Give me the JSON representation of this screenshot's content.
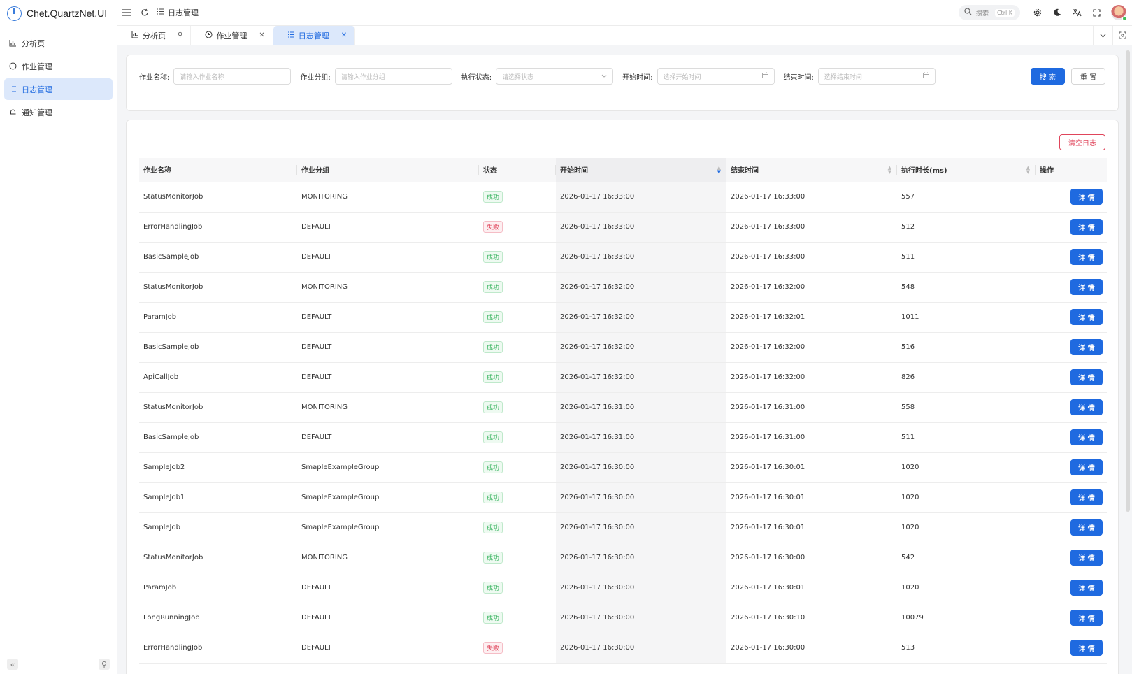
{
  "app": {
    "title": "Chet.QuartzNet.UI"
  },
  "sidebar": {
    "items": [
      {
        "label": "分析页",
        "icon": "chart-icon",
        "active": false
      },
      {
        "label": "作业管理",
        "icon": "clock-icon",
        "active": false
      },
      {
        "label": "日志管理",
        "icon": "list-icon",
        "active": true
      },
      {
        "label": "通知管理",
        "icon": "bell-icon",
        "active": false
      }
    ]
  },
  "header": {
    "breadcrumb": "日志管理",
    "search_placeholder": "搜索",
    "search_shortcut": "Ctrl K"
  },
  "tabs": [
    {
      "label": "分析页",
      "icon": "chart-icon",
      "pinned": true,
      "active": false
    },
    {
      "label": "作业管理",
      "icon": "clock-icon",
      "pinned": false,
      "active": false
    },
    {
      "label": "日志管理",
      "icon": "list-icon",
      "pinned": false,
      "active": true
    }
  ],
  "filters": {
    "job_name": {
      "label": "作业名称:",
      "placeholder": "请输入作业名称"
    },
    "job_group": {
      "label": "作业分组:",
      "placeholder": "请输入作业分组"
    },
    "status": {
      "label": "执行状态:",
      "placeholder": "请选择状态"
    },
    "start_time": {
      "label": "开始时间:",
      "placeholder": "选择开始时间"
    },
    "end_time": {
      "label": "结束时间:",
      "placeholder": "选择结束时间"
    },
    "search_label": "搜 索",
    "reset_label": "重 置"
  },
  "table": {
    "clear_label": "清空日志",
    "columns": [
      "作业名称",
      "作业分组",
      "状态",
      "开始时间",
      "结束时间",
      "执行时长(ms)",
      "操作"
    ],
    "detail_label": "详 情",
    "status_ok": "成功",
    "status_fail": "失败",
    "rows": [
      {
        "name": "StatusMonitorJob",
        "group": "MONITORING",
        "status": "成功",
        "start": "2026-01-17 16:33:00",
        "end": "2026-01-17 16:33:00",
        "duration": "557"
      },
      {
        "name": "ErrorHandlingJob",
        "group": "DEFAULT",
        "status": "失败",
        "start": "2026-01-17 16:33:00",
        "end": "2026-01-17 16:33:00",
        "duration": "512"
      },
      {
        "name": "BasicSampleJob",
        "group": "DEFAULT",
        "status": "成功",
        "start": "2026-01-17 16:33:00",
        "end": "2026-01-17 16:33:00",
        "duration": "511"
      },
      {
        "name": "StatusMonitorJob",
        "group": "MONITORING",
        "status": "成功",
        "start": "2026-01-17 16:32:00",
        "end": "2026-01-17 16:32:00",
        "duration": "548"
      },
      {
        "name": "ParamJob",
        "group": "DEFAULT",
        "status": "成功",
        "start": "2026-01-17 16:32:00",
        "end": "2026-01-17 16:32:01",
        "duration": "1011"
      },
      {
        "name": "BasicSampleJob",
        "group": "DEFAULT",
        "status": "成功",
        "start": "2026-01-17 16:32:00",
        "end": "2026-01-17 16:32:00",
        "duration": "516"
      },
      {
        "name": "ApiCallJob",
        "group": "DEFAULT",
        "status": "成功",
        "start": "2026-01-17 16:32:00",
        "end": "2026-01-17 16:32:00",
        "duration": "826"
      },
      {
        "name": "StatusMonitorJob",
        "group": "MONITORING",
        "status": "成功",
        "start": "2026-01-17 16:31:00",
        "end": "2026-01-17 16:31:00",
        "duration": "558"
      },
      {
        "name": "BasicSampleJob",
        "group": "DEFAULT",
        "status": "成功",
        "start": "2026-01-17 16:31:00",
        "end": "2026-01-17 16:31:00",
        "duration": "511"
      },
      {
        "name": "SampleJob2",
        "group": "SmapleExampleGroup",
        "status": "成功",
        "start": "2026-01-17 16:30:00",
        "end": "2026-01-17 16:30:01",
        "duration": "1020"
      },
      {
        "name": "SampleJob1",
        "group": "SmapleExampleGroup",
        "status": "成功",
        "start": "2026-01-17 16:30:00",
        "end": "2026-01-17 16:30:01",
        "duration": "1020"
      },
      {
        "name": "SampleJob",
        "group": "SmapleExampleGroup",
        "status": "成功",
        "start": "2026-01-17 16:30:00",
        "end": "2026-01-17 16:30:01",
        "duration": "1020"
      },
      {
        "name": "StatusMonitorJob",
        "group": "MONITORING",
        "status": "成功",
        "start": "2026-01-17 16:30:00",
        "end": "2026-01-17 16:30:00",
        "duration": "542"
      },
      {
        "name": "ParamJob",
        "group": "DEFAULT",
        "status": "成功",
        "start": "2026-01-17 16:30:00",
        "end": "2026-01-17 16:30:01",
        "duration": "1020"
      },
      {
        "name": "LongRunningJob",
        "group": "DEFAULT",
        "status": "成功",
        "start": "2026-01-17 16:30:00",
        "end": "2026-01-17 16:30:10",
        "duration": "10079"
      },
      {
        "name": "ErrorHandlingJob",
        "group": "DEFAULT",
        "status": "失败",
        "start": "2026-01-17 16:30:00",
        "end": "2026-01-17 16:30:00",
        "duration": "513"
      }
    ]
  },
  "colors": {
    "primary": "#1f6ae0",
    "danger": "#e0455b",
    "success": "#36b35d"
  }
}
